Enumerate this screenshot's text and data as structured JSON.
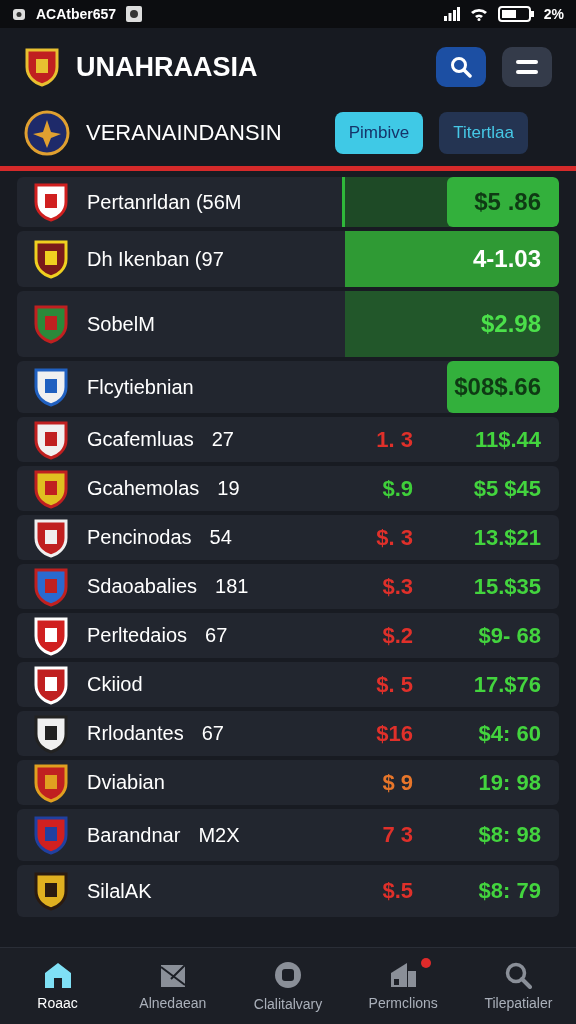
{
  "status_bar": {
    "time": "ACAtber657",
    "battery": "2%"
  },
  "header": {
    "title": "UNAHRAASIA",
    "subtitle": "VERANAINDANSIN"
  },
  "tabs": [
    {
      "label": "Pimbive",
      "selected": true
    },
    {
      "label": "Titertlaa",
      "selected": false
    }
  ],
  "featured": [
    {
      "kind": "split",
      "name": "Pertanrldan (56M",
      "price": "$5 .86"
    },
    {
      "kind": "full",
      "name": "Dh Ikenban (97",
      "price": "4-1.03"
    },
    {
      "kind": "dim",
      "name": "SobelM",
      "price": "$2.98"
    },
    {
      "kind": "box",
      "name": "Flcytiebnian",
      "price": "$08$.66"
    }
  ],
  "rows": [
    {
      "name": "Gcafemluas",
      "number": "27",
      "change": "1. 3",
      "color": "#e0302a",
      "price": "11$.44"
    },
    {
      "name": "Gcahemolas",
      "number": "19",
      "change": "$.9",
      "color": "#3fcf3a",
      "price": "$5 $45"
    },
    {
      "name": "Pencinodas",
      "number": "54",
      "change": "$. 3",
      "color": "#e0302a",
      "price": "13.$21"
    },
    {
      "name": "Sdaoabalies",
      "number": "181",
      "change": "$.3",
      "color": "#e0302a",
      "price": "15.$35"
    },
    {
      "name": "Perltedaios",
      "number": "67",
      "change": "$.2",
      "color": "#e0302a",
      "price": "$9- 68"
    },
    {
      "name": "Ckiiod",
      "change": "$. 5",
      "color": "#e0302a",
      "price": "17.$76"
    },
    {
      "name": "Rrlodantes",
      "number": "67",
      "change": "$16",
      "color": "#e0302a",
      "price": "$4: 60"
    },
    {
      "name": "Dviabian",
      "change": "$ 9",
      "color": "#e8762a",
      "price": "19: 98"
    },
    {
      "name": "Barandnar",
      "number": "M2X",
      "change": "7 3",
      "color": "#e0302a",
      "price": "$8: 98"
    },
    {
      "name": "SilalAK",
      "change": "$.5",
      "color": "#e0302a",
      "price": "$8: 79"
    }
  ],
  "nav": [
    {
      "label": "Roaac",
      "selected": true,
      "badge": false
    },
    {
      "label": "Alnedaean",
      "selected": false,
      "badge": false
    },
    {
      "label": "Clalitalvary",
      "selected": false,
      "badge": false
    },
    {
      "label": "Permclions",
      "selected": false,
      "badge": true
    },
    {
      "label": "Tilepatialer",
      "selected": false,
      "badge": false
    }
  ]
}
